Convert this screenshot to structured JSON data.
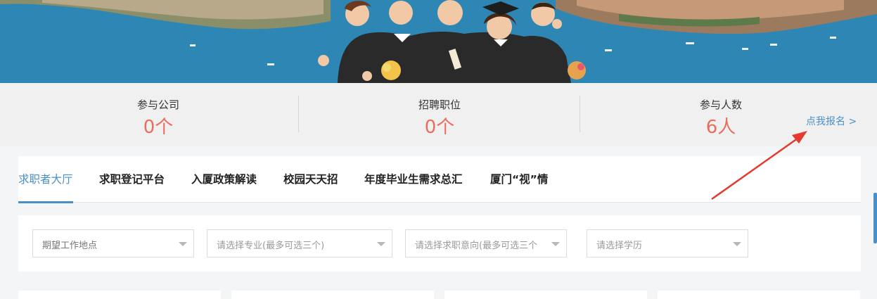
{
  "stats": [
    {
      "label": "参与公司",
      "value": "0个"
    },
    {
      "label": "招聘职位",
      "value": "0个"
    },
    {
      "label": "参与人数",
      "value": "6人"
    }
  ],
  "signup_link": "点我报名 >",
  "tabs": [
    {
      "label": "求职者大厅",
      "active": true
    },
    {
      "label": "求职登记平台",
      "active": false
    },
    {
      "label": "入厦政策解读",
      "active": false
    },
    {
      "label": "校园天天招",
      "active": false
    },
    {
      "label": "年度毕业生需求总汇",
      "active": false
    },
    {
      "label": "厦门“视”情",
      "active": false
    }
  ],
  "filters": [
    {
      "placeholder": "期望工作地点"
    },
    {
      "placeholder": "请选择专业(最多可选三个)"
    },
    {
      "placeholder": "请选择求职意向(最多可选三个"
    },
    {
      "placeholder": "请选择学历"
    }
  ],
  "colors": {
    "accent": "#4a90c8",
    "stat_value": "#e76e5c",
    "annotation_arrow": "#e53a2e"
  }
}
